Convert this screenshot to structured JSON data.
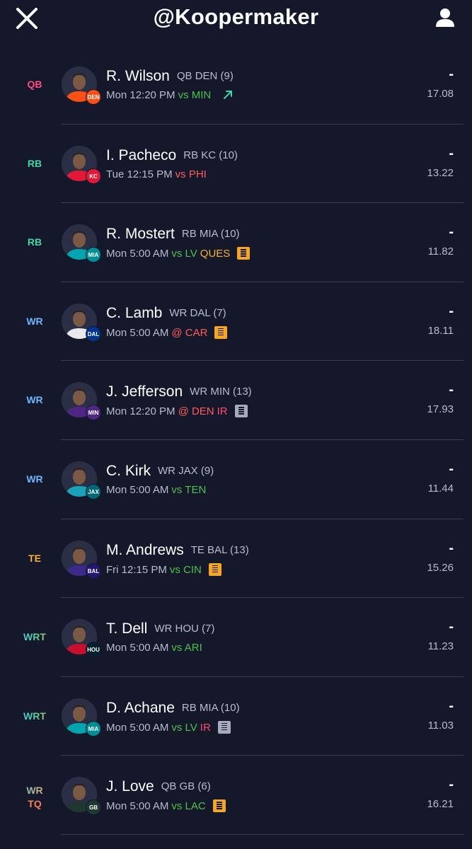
{
  "header": {
    "title": "@Koopermaker"
  },
  "colors": {
    "background": "#14182a",
    "qb": "#ff4d7e",
    "rb": "#42d6a4",
    "wr": "#6fb6ff",
    "te": "#f7b233",
    "opp_good": "#4cc24a",
    "opp_bad": "#ff5d5d",
    "ques": "#f7b233",
    "ir": "#ff4d6a"
  },
  "roster": [
    {
      "slot": "QB",
      "slot2": "",
      "name": "R. Wilson",
      "meta": "QB DEN (9)",
      "time": "Mon 12:20 PM",
      "opp": "vs MIN",
      "opp_kind": "vs",
      "status": "",
      "note": "trend",
      "dash": "-",
      "proj": "17.08",
      "team": "DEN",
      "team_color": "#fb4f14",
      "jersey": "#fb4f14"
    },
    {
      "slot": "RB",
      "slot2": "",
      "name": "I. Pacheco",
      "meta": "RB KC (10)",
      "time": "Tue 12:15 PM",
      "opp": "vs PHI",
      "opp_kind": "vs-bad",
      "status": "",
      "note": "",
      "dash": "-",
      "proj": "13.22",
      "team": "KC",
      "team_color": "#e31837",
      "jersey": "#e31837"
    },
    {
      "slot": "RB",
      "slot2": "",
      "name": "R. Mostert",
      "meta": "RB MIA (10)",
      "time": "Mon 5:00 AM",
      "opp": "vs LV",
      "opp_kind": "vs",
      "status": "QUES",
      "status_kind": "ques",
      "note": "orange",
      "dash": "-",
      "proj": "11.82",
      "team": "MIA",
      "team_color": "#008e97",
      "jersey": "#00a5b0"
    },
    {
      "slot": "WR",
      "slot2": "",
      "name": "C. Lamb",
      "meta": "WR DAL (7)",
      "time": "Mon 5:00 AM",
      "opp": "@ CAR",
      "opp_kind": "at",
      "status": "",
      "note": "orange",
      "dash": "-",
      "proj": "18.11",
      "team": "DAL",
      "team_color": "#003594",
      "jersey": "#e8e8ee"
    },
    {
      "slot": "WR",
      "slot2": "",
      "name": "J. Jefferson",
      "meta": "WR MIN (13)",
      "time": "Mon 12:20 PM",
      "opp": "@ DEN",
      "opp_kind": "at",
      "status": "IR",
      "status_kind": "ir",
      "note": "gray",
      "dash": "-",
      "proj": "17.93",
      "team": "MIN",
      "team_color": "#4f2683",
      "jersey": "#4f2683"
    },
    {
      "slot": "WR",
      "slot2": "",
      "name": "C. Kirk",
      "meta": "WR JAX (9)",
      "time": "Mon 5:00 AM",
      "opp": "vs TEN",
      "opp_kind": "vs",
      "status": "",
      "note": "",
      "dash": "-",
      "proj": "11.44",
      "team": "JAX",
      "team_color": "#006778",
      "jersey": "#1aa3b8"
    },
    {
      "slot": "TE",
      "slot2": "",
      "name": "M. Andrews",
      "meta": "TE BAL (13)",
      "time": "Fri 12:15 PM",
      "opp": "vs CIN",
      "opp_kind": "vs",
      "status": "",
      "note": "orange",
      "dash": "-",
      "proj": "15.26",
      "team": "BAL",
      "team_color": "#241773",
      "jersey": "#3b2a8a"
    },
    {
      "slot": "WRT",
      "slot2": "",
      "name": "T. Dell",
      "meta": "WR HOU (7)",
      "time": "Mon 5:00 AM",
      "opp": "vs ARI",
      "opp_kind": "vs",
      "status": "",
      "note": "",
      "dash": "-",
      "proj": "11.23",
      "team": "HOU",
      "team_color": "#03202f",
      "jersey": "#c8102e"
    },
    {
      "slot": "WRT",
      "slot2": "",
      "name": "D. Achane",
      "meta": "RB MIA (10)",
      "time": "Mon 5:00 AM",
      "opp": "vs LV",
      "opp_kind": "vs",
      "status": "IR",
      "status_kind": "ir",
      "note": "gray",
      "dash": "-",
      "proj": "11.03",
      "team": "MIA",
      "team_color": "#008e97",
      "jersey": "#00a5b0"
    },
    {
      "slot": "WR",
      "slot2": "TQ",
      "name": "J. Love",
      "meta": "QB GB (6)",
      "time": "Mon 5:00 AM",
      "opp": "vs LAC",
      "opp_kind": "vs",
      "status": "",
      "note": "orange",
      "dash": "-",
      "proj": "16.21",
      "team": "GB",
      "team_color": "#203731",
      "jersey": "#203731"
    }
  ]
}
